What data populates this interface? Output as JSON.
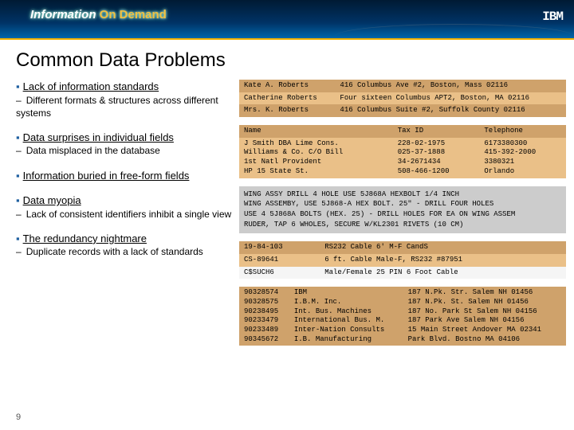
{
  "header": {
    "brand_a": "Information",
    "brand_b": "On Demand",
    "logo": "IBM"
  },
  "title": "Common Data Problems",
  "sections": [
    {
      "heading": "Lack of information standards",
      "subs": [
        "Different formats & structures across different systems"
      ]
    },
    {
      "heading": "Data surprises in individual fields",
      "subs": [
        "Data misplaced in the database"
      ]
    },
    {
      "heading": "Information buried in free-form fields",
      "subs": []
    },
    {
      "heading": "Data myopia",
      "subs": [
        "Lack of consistent identifiers inhibit a single view"
      ]
    },
    {
      "heading": "The redundancy nightmare",
      "subs": [
        "Duplicate records with a lack of standards"
      ]
    }
  ],
  "ex1": [
    [
      "Kate A. Roberts",
      "416 Columbus Ave #2, Boston, Mass 02116"
    ],
    [
      "Catherine Roberts",
      "Four sixteen Columbus APT2, Boston, MA 02116"
    ],
    [
      "Mrs. K. Roberts",
      "416 Columbus Suite #2, Suffolk County 02116"
    ]
  ],
  "ex2": {
    "headers": [
      "Name",
      "Tax ID",
      "Telephone"
    ],
    "rows": [
      [
        "J Smith DBA Lime Cons.",
        "228-02-1975",
        "6173380300"
      ],
      [
        "Williams & Co. C/O Bill",
        "025-37-1888",
        "415-392-2000"
      ],
      [
        "1st Natl Provident",
        "34-2671434",
        "3380321"
      ],
      [
        "HP 15 State St.",
        "508-466-1200",
        "Orlando"
      ]
    ]
  },
  "ex3": [
    "WING ASSY DRILL 4 HOLE USE 5J868A HEXBOLT 1/4 INCH",
    "WING ASSEMBY, USE 5J868-A HEX BOLT. 25\" - DRILL FOUR HOLES",
    "USE 4 5J868A BOLTS (HEX. 25) - DRILL HOLES FOR EA ON WING ASSEM",
    "RUDER, TAP 6 WHOLES, SECURE W/KL2301 RIVETS (10 CM)"
  ],
  "ex4": [
    [
      "19-84-103",
      "RS232 Cable 6' M-F CandS"
    ],
    [
      "CS-89641",
      "6 ft. Cable Male-F, RS232 #87951"
    ],
    [
      "C$SUCH6",
      "Male/Female 25 PIN 6 Foot Cable"
    ]
  ],
  "ex5": {
    "rows": [
      [
        "90328574",
        "IBM",
        "187 N.Pk. Str. Salem NH 01456"
      ],
      [
        "90328575",
        "I.B.M. Inc.",
        "187 N.Pk. St. Salem NH 01456"
      ],
      [
        "90238495",
        "Int. Bus. Machines",
        "187 No. Park St Salem NH 04156"
      ],
      [
        "90233479",
        "International Bus. M.",
        "187 Park Ave Salem NH 04156"
      ],
      [
        "90233489",
        "Inter-Nation Consults",
        "15 Main Street Andover MA 02341"
      ],
      [
        "90345672",
        "I.B. Manufacturing",
        "Park Blvd. Bostno MA 04106"
      ]
    ]
  },
  "page_number": "9"
}
